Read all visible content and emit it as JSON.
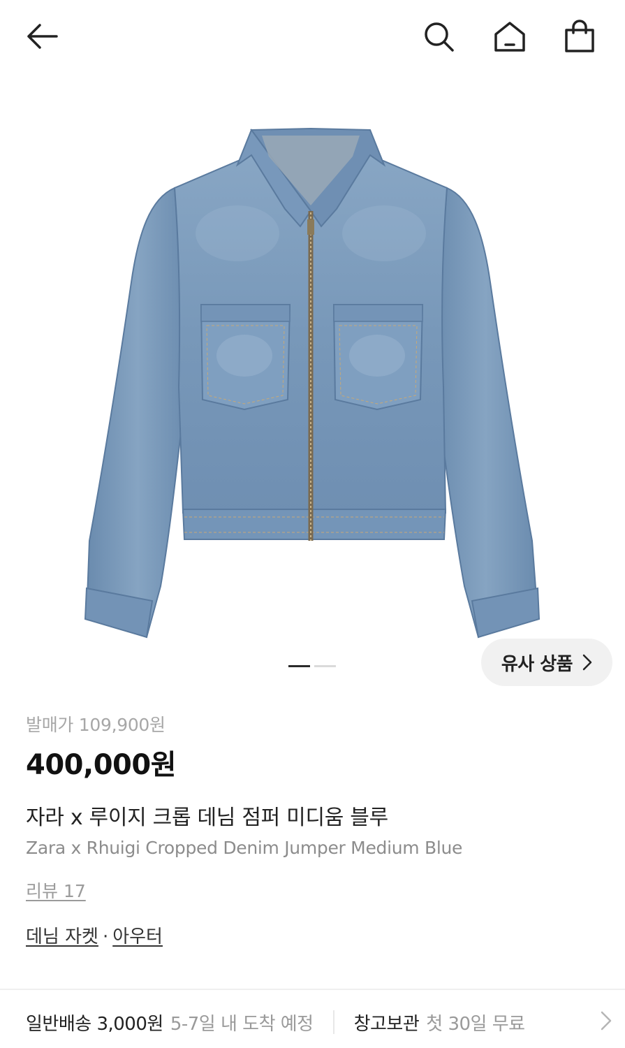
{
  "header": {
    "back_icon": "arrow-left-icon",
    "search_icon": "search-icon",
    "home_icon": "home-icon",
    "bag_icon": "shopping-bag-icon"
  },
  "gallery": {
    "image": "denim-jacket-image",
    "slide_count": 2,
    "active_slide": 1,
    "similar_button": "유사 상품"
  },
  "product": {
    "release_price": "발매가 109,900원",
    "price": "400,000원",
    "name_ko": "자라 x 루이지 크롭 데님 점퍼 미디움 블루",
    "name_en": "Zara x Rhuigi Cropped Denim Jumper Medium Blue",
    "reviews": "리뷰 17",
    "categories": [
      "데님 자켓",
      "아우터"
    ],
    "category_separator": "·"
  },
  "shipping": {
    "standard_label": "일반배송 3,000원",
    "standard_eta": "5-7일 내 도착 예정",
    "storage_label": "창고보관",
    "storage_offer": "첫 30일 무료"
  },
  "colors": {
    "denim": "#7d9dbd",
    "denim_dark": "#5d7fa3",
    "text": "#222222",
    "muted": "#a7a7a7"
  }
}
